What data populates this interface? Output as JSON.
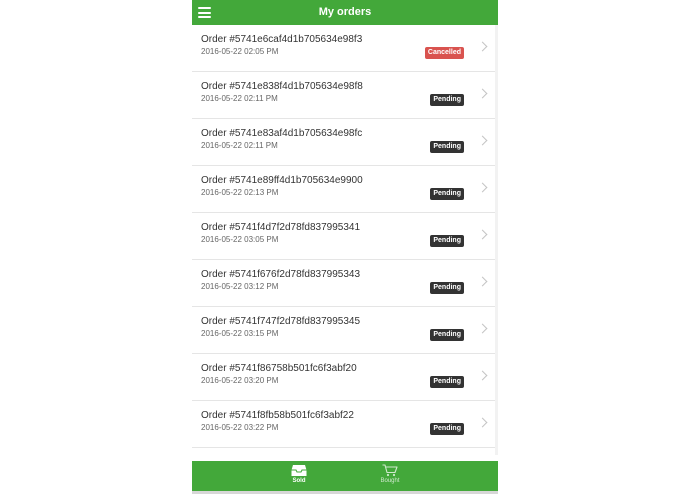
{
  "header": {
    "title": "My orders",
    "menu_icon": "hamburger-menu-icon"
  },
  "colors": {
    "brand": "#43a83a",
    "cancelled": "#d9534f",
    "pending": "#333333"
  },
  "orders": [
    {
      "title": "Order #5741e6caf4d1b705634e98f3",
      "date": "2016-05-22 02:05 PM",
      "status": "Cancelled"
    },
    {
      "title": "Order #5741e838f4d1b705634e98f8",
      "date": "2016-05-22 02:11 PM",
      "status": "Pending"
    },
    {
      "title": "Order #5741e83af4d1b705634e98fc",
      "date": "2016-05-22 02:11 PM",
      "status": "Pending"
    },
    {
      "title": "Order #5741e89ff4d1b705634e9900",
      "date": "2016-05-22 02:13 PM",
      "status": "Pending"
    },
    {
      "title": "Order #5741f4d7f2d78fd837995341",
      "date": "2016-05-22 03:05 PM",
      "status": "Pending"
    },
    {
      "title": "Order #5741f676f2d78fd837995343",
      "date": "2016-05-22 03:12 PM",
      "status": "Pending"
    },
    {
      "title": "Order #5741f747f2d78fd837995345",
      "date": "2016-05-22 03:15 PM",
      "status": "Pending"
    },
    {
      "title": "Order #5741f86758b501fc6f3abf20",
      "date": "2016-05-22 03:20 PM",
      "status": "Pending"
    },
    {
      "title": "Order #5741f8fb58b501fc6f3abf22",
      "date": "2016-05-22 03:22 PM",
      "status": "Pending"
    }
  ],
  "tabs": {
    "sold": {
      "label": "Sold",
      "icon": "inbox-tray-icon",
      "active": true
    },
    "bought": {
      "label": "Bought",
      "icon": "shopping-cart-icon",
      "active": false
    }
  }
}
